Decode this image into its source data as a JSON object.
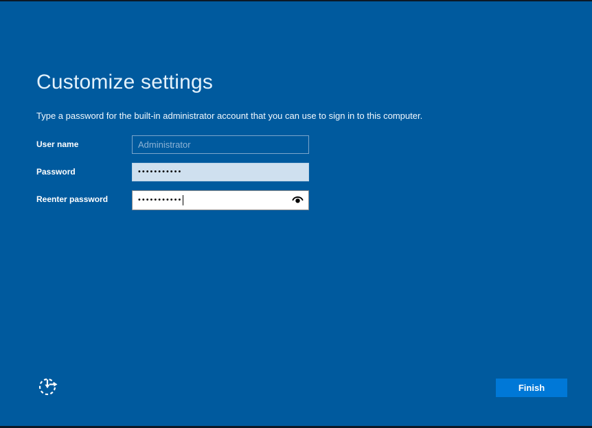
{
  "theme": {
    "background": "#005A9E",
    "edge_strip": "#0B1826",
    "accent_button": "#0078D7",
    "filled_field_bg": "#CFE0EF",
    "focused_field_bg": "#FFFFFF"
  },
  "page": {
    "title": "Customize settings",
    "description": "Type a password for the built-in administrator account that you can use to sign in to this computer."
  },
  "form": {
    "fields": [
      {
        "label": "User name",
        "value": "Administrator",
        "state": "disabled"
      },
      {
        "label": "Password",
        "masked_value": "•••••••••••",
        "state": "filled"
      },
      {
        "label": "Reenter password",
        "masked_value": "•••••••••••",
        "state": "focused"
      }
    ]
  },
  "icons": {
    "reveal_password": "eye-icon",
    "ease_of_access": "ease-of-access-icon"
  },
  "footer": {
    "finish_label": "Finish"
  }
}
